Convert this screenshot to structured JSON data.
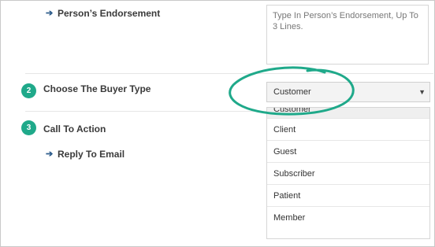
{
  "endorsement": {
    "label": "Person’s Endorsement",
    "placeholder": "Type In Person’s Endorsement, Up To 3 Lines."
  },
  "steps": [
    {
      "number": "2",
      "label": "Choose The Buyer Type"
    },
    {
      "number": "3",
      "label": "Call To Action"
    }
  ],
  "reply": {
    "label": "Reply To Email"
  },
  "select": {
    "value": "Customer"
  },
  "options": [
    "Customer",
    "Client",
    "Guest",
    "Subscriber",
    "Patient",
    "Member"
  ],
  "colors": {
    "accent": "#1fa98a",
    "arrow": "#2e5d8c"
  },
  "icons": {
    "arrow": "arrow-right-icon",
    "caret": "chevron-down-icon"
  }
}
